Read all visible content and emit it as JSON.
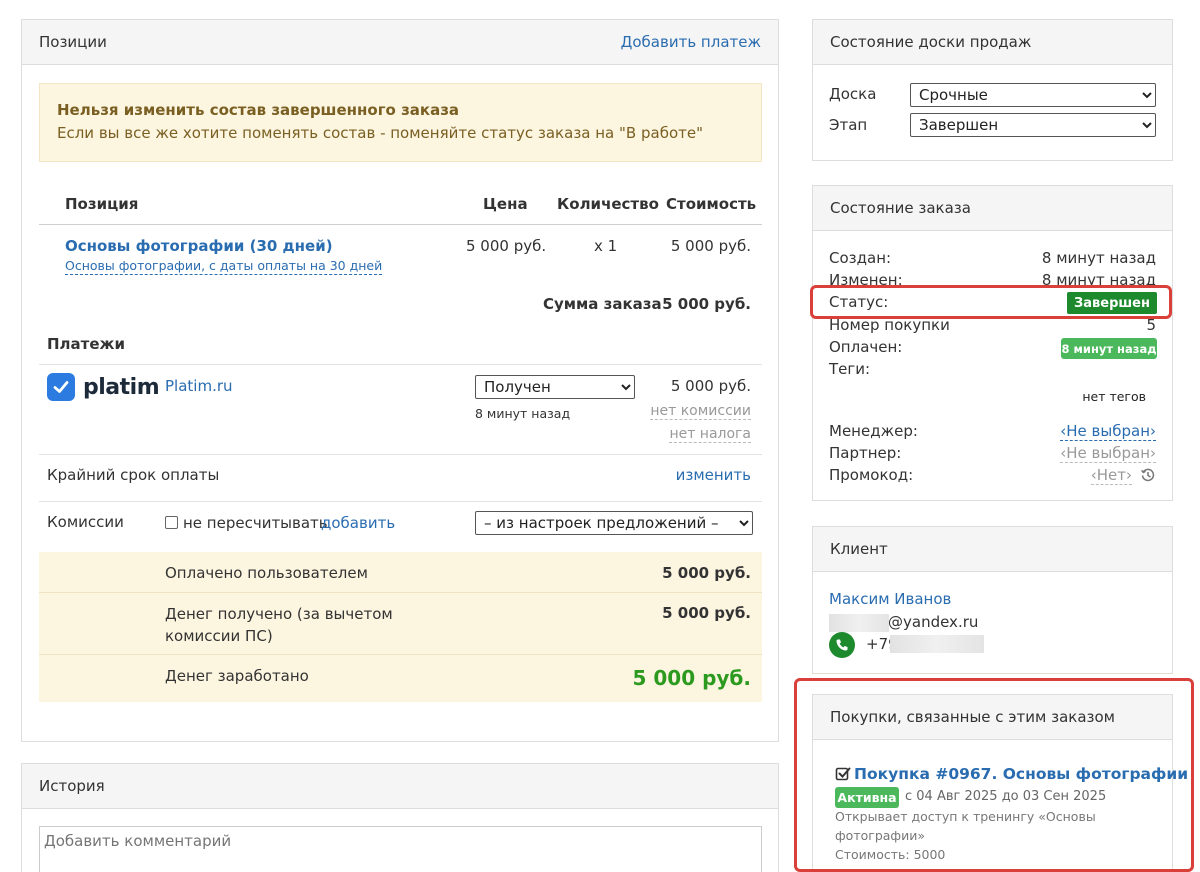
{
  "positions_panel": {
    "title": "Позиции",
    "add_payment": "Добавить платеж",
    "warning_title": "Нельзя изменить состав завершенного заказа",
    "warning_text": "Если вы все же хотите поменять состав - поменяйте статус заказа на \"В работе\"",
    "columns": [
      "Позиция",
      "Цена",
      "Количество",
      "Стоимость"
    ],
    "item": {
      "name": "Основы фотографии (30 дней)",
      "subname": "Основы фотографии, с даты оплаты на 30 дней",
      "price": "5 000 руб.",
      "qty": "x 1",
      "cost": "5 000 руб."
    },
    "total_label": "Сумма заказа",
    "total_value": "5 000 руб.",
    "payments_title": "Платежи",
    "payment": {
      "logo_text": "platim",
      "name": "Platim.ru",
      "status_selected": "Получен",
      "time": "8 минут назад",
      "amount": "5 000 руб.",
      "no_commission": "нет комиссии",
      "no_tax": "нет налога"
    },
    "deadline_label": "Крайний срок оплаты",
    "deadline_change": "изменить",
    "commissions_label": "Комиссии",
    "no_recalc": "не пересчитывать",
    "add": "добавить",
    "commission_select": "– из настроек предложений –",
    "summary": [
      {
        "label": "Оплачено пользователем",
        "value": "5 000 руб."
      },
      {
        "label": "Денег получено (за вычетом комиссии ПС)",
        "value": "5 000 руб."
      },
      {
        "label": "Денег заработано",
        "value": "5 000 руб."
      }
    ]
  },
  "history_panel": {
    "title": "История",
    "comment_placeholder": "Добавить комментарий"
  },
  "board_panel": {
    "title": "Состояние доски продаж",
    "board_label": "Доска",
    "board_value": "Срочные",
    "stage_label": "Этап",
    "stage_value": "Завершен"
  },
  "order_panel": {
    "title": "Состояние заказа",
    "created_label": "Создан:",
    "created_value": "8 минут назад",
    "changed_label": "Изменен:",
    "changed_value": "8 минут назад",
    "status_label": "Статус:",
    "status_value": "Завершен",
    "purchase_no_label": "Номер покупки",
    "purchase_no_value": "5",
    "paid_label": "Оплачен:",
    "paid_value": "8 минут назад",
    "tags_label": "Теги:",
    "tags_value": "нет тегов",
    "manager_label": "Менеджер:",
    "manager_value": "‹Не выбран›",
    "partner_label": "Партнер:",
    "partner_value": "‹Не выбран›",
    "promo_label": "Промокод:",
    "promo_value": "‹Нет›"
  },
  "client_panel": {
    "title": "Клиент",
    "name": "Максим Иванов",
    "email_suffix": "@yandex.ru",
    "phone_prefix": "+79"
  },
  "purchases_panel": {
    "title": "Покупки, связанные с этим заказом",
    "purchase_title": "Покупка #0967. Основы фотографии",
    "badge": "Активна",
    "period": "с 04 Авг 2025 до 03 Сен 2025",
    "desc_line1": "Открывает доступ к тренингу «Основы",
    "desc_line2": "фотографии»",
    "cost": "Стоимость: 5000"
  },
  "colors": {
    "link": "#2a6cb0",
    "warning_bg": "#fcf5e0",
    "status_green": "#1e8a2e",
    "paid_green": "#4cb85c",
    "highlight_red": "#d9403a",
    "earned_green": "#2c9a1e"
  }
}
